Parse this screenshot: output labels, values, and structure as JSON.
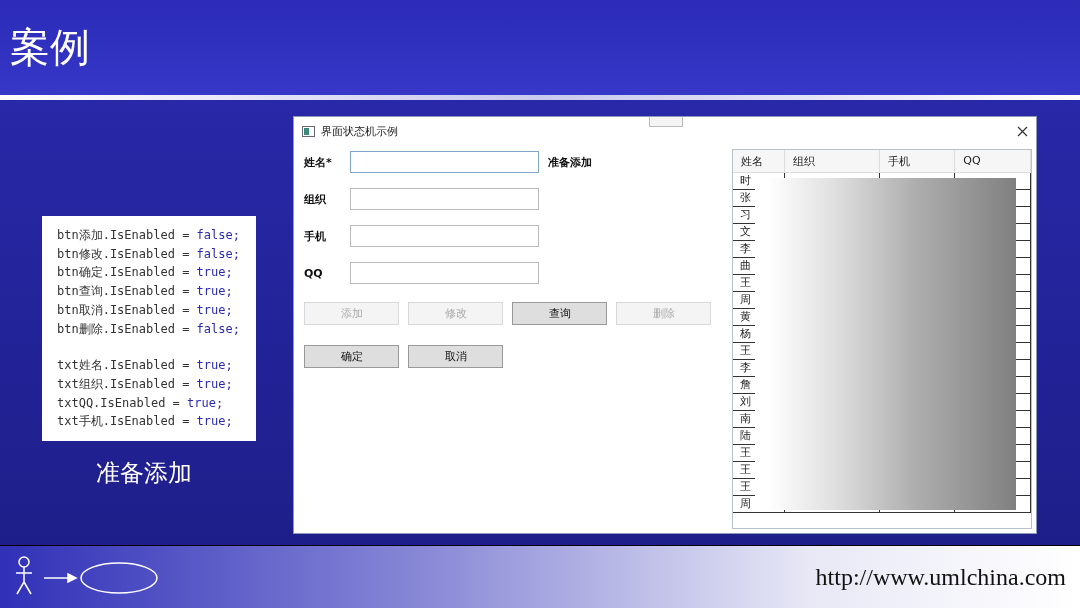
{
  "slide": {
    "title": "案例"
  },
  "code_blocks": [
    [
      {
        "text": "btn添加.IsEnabled = ",
        "value": "false;"
      },
      {
        "text": "btn修改.IsEnabled = ",
        "value": "false;"
      },
      {
        "text": "btn确定.IsEnabled = ",
        "value": "true;"
      },
      {
        "text": "btn查询.IsEnabled = ",
        "value": "true;"
      },
      {
        "text": "btn取消.IsEnabled = ",
        "value": "true;"
      },
      {
        "text": "btn删除.IsEnabled = ",
        "value": "false;"
      }
    ],
    [
      {
        "text": "txt姓名.IsEnabled = ",
        "value": "true;"
      },
      {
        "text": "txt组织.IsEnabled = ",
        "value": "true;"
      },
      {
        "text": "txtQQ.IsEnabled = ",
        "value": "true;"
      },
      {
        "text": "txt手机.IsEnabled = ",
        "value": "true;"
      }
    ]
  ],
  "caption": "准备添加",
  "window": {
    "title": "界面状态机示例",
    "fields": [
      {
        "label": "姓名*",
        "focused": true
      },
      {
        "label": "组织",
        "focused": false
      },
      {
        "label": "手机",
        "focused": false
      },
      {
        "label": "QQ",
        "focused": false
      }
    ],
    "status": "准备添加",
    "buttons": [
      {
        "label": "添加",
        "disabled": true
      },
      {
        "label": "修改",
        "disabled": true
      },
      {
        "label": "查询",
        "disabled": false
      },
      {
        "label": "删除",
        "disabled": true
      }
    ],
    "buttons_2": [
      {
        "label": "确定",
        "disabled": false
      },
      {
        "label": "取消",
        "disabled": false
      }
    ],
    "table": {
      "columns": [
        "姓名",
        "组织",
        "手机",
        "QQ"
      ],
      "rows": [
        "时",
        "张",
        "习",
        "文",
        "李",
        "曲",
        "王",
        "周",
        "黄",
        "杨",
        "王",
        "李",
        "詹",
        "刘",
        "南",
        "陆",
        "王",
        "王",
        "王",
        "周"
      ]
    }
  },
  "footer": {
    "url": "http://www.umlchina.com"
  }
}
